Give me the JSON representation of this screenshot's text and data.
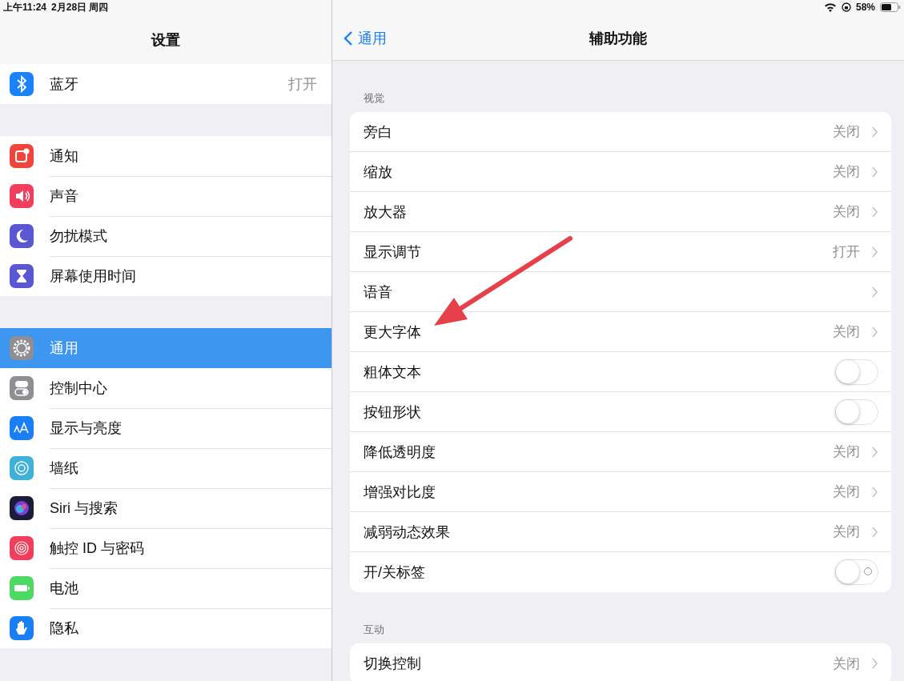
{
  "status_bar": {
    "time": "上午11:24",
    "date": "2月28日 周四",
    "battery": "58%"
  },
  "sidebar": {
    "title": "设置",
    "groups": [
      {
        "items": [
          {
            "label": "蓝牙",
            "value": "打开",
            "selected": false
          }
        ]
      },
      {
        "items": [
          {
            "label": "通知",
            "selected": false
          },
          {
            "label": "声音",
            "selected": false
          },
          {
            "label": "勿扰模式",
            "selected": false
          },
          {
            "label": "屏幕使用时间",
            "selected": false
          }
        ]
      },
      {
        "items": [
          {
            "label": "通用",
            "selected": true
          },
          {
            "label": "控制中心",
            "selected": false
          },
          {
            "label": "显示与亮度",
            "selected": false
          },
          {
            "label": "墙纸",
            "selected": false
          },
          {
            "label": "Siri 与搜索",
            "selected": false
          },
          {
            "label": "触控 ID 与密码",
            "selected": false
          },
          {
            "label": "电池",
            "selected": false
          },
          {
            "label": "隐私",
            "selected": false
          }
        ]
      }
    ]
  },
  "detail": {
    "back": "通用",
    "title": "辅助功能",
    "sections": [
      {
        "header": "视觉",
        "rows": [
          {
            "kind": "link",
            "label": "旁白",
            "value": "关闭"
          },
          {
            "kind": "link",
            "label": "缩放",
            "value": "关闭"
          },
          {
            "kind": "link",
            "label": "放大器",
            "value": "关闭"
          },
          {
            "kind": "link",
            "label": "显示调节",
            "value": "打开"
          },
          {
            "kind": "link",
            "label": "语音"
          },
          {
            "kind": "link",
            "label": "更大字体",
            "value": "关闭"
          },
          {
            "kind": "toggle",
            "label": "粗体文本",
            "on": false,
            "labels": false
          },
          {
            "kind": "toggle",
            "label": "按钮形状",
            "on": false,
            "labels": false
          },
          {
            "kind": "link",
            "label": "降低透明度",
            "value": "关闭"
          },
          {
            "kind": "link",
            "label": "增强对比度",
            "value": "关闭"
          },
          {
            "kind": "link",
            "label": "减弱动态效果",
            "value": "关闭"
          },
          {
            "kind": "toggle",
            "label": "开/关标签",
            "on": false,
            "labels": true
          }
        ]
      },
      {
        "header": "互动",
        "rows": [
          {
            "kind": "link",
            "label": "切换控制",
            "value": "关闭"
          }
        ]
      }
    ]
  }
}
